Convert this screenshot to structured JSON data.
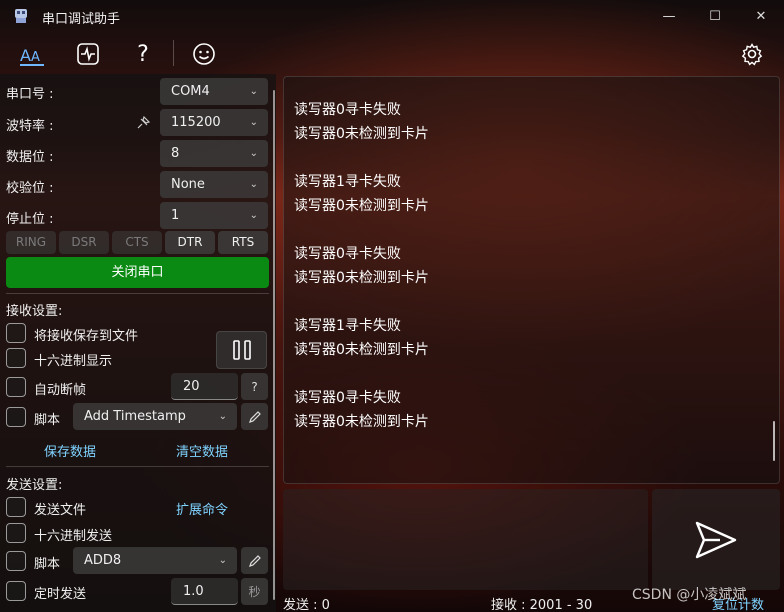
{
  "window": {
    "title": "串口调试助手",
    "minimize_glyph": "—",
    "maximize_glyph": "☐",
    "close_glyph": "✕"
  },
  "toolbar": {
    "icons": [
      "font-icon",
      "waveform-icon",
      "help-icon",
      "smiley-icon",
      "settings-icon"
    ],
    "help_glyph": "?"
  },
  "serial": {
    "port_label": "串口号 :",
    "port_value": "COM4",
    "baud_label": "波特率 :",
    "baud_value": "115200",
    "databits_label": "数据位 :",
    "databits_value": "8",
    "parity_label": "校验位 :",
    "parity_value": "None",
    "stopbits_label": "停止位 :",
    "stopbits_value": "1",
    "signals": [
      "RING",
      "DSR",
      "CTS",
      "DTR",
      "RTS"
    ],
    "close_port_label": "关闭串口"
  },
  "receive_settings": {
    "title": "接收设置:",
    "save_to_file": "将接收保存到文件",
    "hex_display": "十六进制显示",
    "auto_frame": "自动断帧",
    "auto_frame_value": "20",
    "help_glyph": "?",
    "script_label": "脚本",
    "script_value": "Add Timestamp",
    "save_data": "保存数据",
    "clear_data": "清空数据"
  },
  "send_settings": {
    "title": "发送设置:",
    "send_file": "发送文件",
    "extend_cmd": "扩展命令",
    "hex_send": "十六进制发送",
    "script_label": "脚本",
    "script_value": "ADD8",
    "timed_send": "定时发送",
    "timed_value": "1.0",
    "unit": "秒"
  },
  "receive_log": [
    "读写器0寻卡失败",
    "读写器0未检测到卡片",
    "读写器1寻卡失败",
    "读写器0未检测到卡片",
    "读写器0寻卡失败",
    "读写器0未检测到卡片",
    "读写器1寻卡失败",
    "读写器0未检测到卡片",
    "读写器0寻卡失败",
    "读写器0未检测到卡片"
  ],
  "status": {
    "send_label": "发送 : 0",
    "recv_label": "接收 : 2001 - 30",
    "reset_count": "复位计数"
  },
  "watermark": "CSDN @小凌斌斌",
  "colors": {
    "accent_green": "#0b8a13",
    "link_blue": "#7fd3ff"
  }
}
